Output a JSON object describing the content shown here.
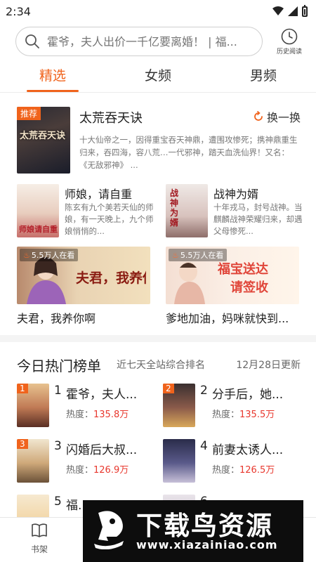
{
  "status": {
    "time": "2:34"
  },
  "search": {
    "placeholder": "霍爷，夫人出价一千亿要离婚！ | 福...",
    "history_label": "历史阅读"
  },
  "tabs": [
    {
      "label": "精选",
      "active": true
    },
    {
      "label": "女频",
      "active": false
    },
    {
      "label": "男频",
      "active": false
    }
  ],
  "recommend": {
    "badge": "推荐",
    "cover_text": "太荒吞天诀",
    "title": "太荒吞天诀",
    "swap_label": "换一换",
    "description": "十大仙帝之一，因得重宝吞天神鼎，遭围攻惨死；携神鼎重生归来，吞四海，容八荒…一代邪神，踏天血洗仙界！又名：《无敌邪神》 ..."
  },
  "mini_books": [
    {
      "title": "师娘，请自重",
      "cover_text": "师娘请自重",
      "description": "陈玄有九个美若天仙的师娘，有一天晚上，九个师娘悄悄的..."
    },
    {
      "title": "战神为婿",
      "cover_text": "战神为婿",
      "description": "十年戎马，封号战神。当麒麟战神荣耀归来，却遇父母惨死..."
    }
  ],
  "banners": [
    {
      "viewers": "5.5万人在看",
      "art_text": "夫君，我养你啊",
      "caption": "夫君，我养你啊"
    },
    {
      "viewers": "5.5万人在看",
      "art_text_1": "福宝送达",
      "art_text_2": "请签收",
      "caption": "爹地加油，妈咪就快到..."
    }
  ],
  "ranking": {
    "title": "今日热门榜单",
    "subtitle": "近七天全站综合排名",
    "date": "12月28日更新",
    "heat_label": "热度：",
    "items": [
      {
        "rank": "1",
        "name": "霍爷，夫人...",
        "heat": "135.8万"
      },
      {
        "rank": "2",
        "name": "分手后，她...",
        "heat": "135.5万"
      },
      {
        "rank": "3",
        "name": "闪婚后大叔...",
        "heat": "126.9万"
      },
      {
        "rank": "4",
        "name": "前妻太诱人...",
        "heat": "126.5万"
      },
      {
        "rank": "5",
        "name": "福...",
        "heat": ""
      },
      {
        "rank": "6",
        "name": "...",
        "heat": ""
      }
    ]
  },
  "bottom_nav": {
    "bookshelf_label": "书架"
  },
  "watermark": {
    "brand": "下载鸟资源",
    "url": "www.xiazainiao.com"
  },
  "colors": {
    "accent": "#f0631c",
    "heat": "#e8382e"
  }
}
